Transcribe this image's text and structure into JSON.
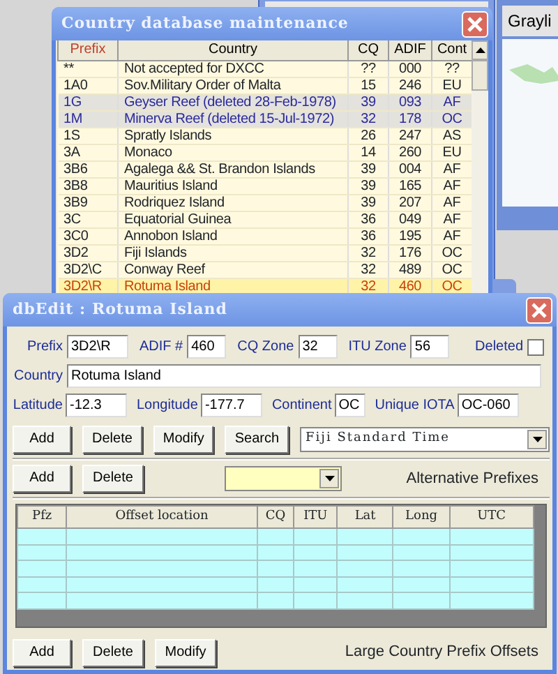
{
  "desktop": {
    "side_tab": "Grayli"
  },
  "country_window": {
    "title": "Country database maintenance",
    "columns": [
      {
        "label": "Prefix",
        "sorted": true
      },
      {
        "label": "Country",
        "sorted": false
      },
      {
        "label": "CQ",
        "sorted": false
      },
      {
        "label": "ADIF",
        "sorted": false
      },
      {
        "label": "Cont",
        "sorted": false
      }
    ],
    "rows": [
      {
        "prefix": "**",
        "country": "Not accepted for DXCC",
        "cq": "??",
        "adif": "000",
        "cont": "??",
        "deleted": false,
        "selected": false
      },
      {
        "prefix": "1A0",
        "country": "Sov.Military Order of Malta",
        "cq": "15",
        "adif": "246",
        "cont": "EU",
        "deleted": false,
        "selected": false
      },
      {
        "prefix": "1G",
        "country": "Geyser Reef  (deleted 28-Feb-1978)",
        "cq": "39",
        "adif": "093",
        "cont": "AF",
        "deleted": true,
        "selected": false
      },
      {
        "prefix": "1M",
        "country": "Minerva Reef  (deleted 15-Jul-1972)",
        "cq": "32",
        "adif": "178",
        "cont": "OC",
        "deleted": true,
        "selected": false
      },
      {
        "prefix": "1S",
        "country": "Spratly Islands",
        "cq": "26",
        "adif": "247",
        "cont": "AS",
        "deleted": false,
        "selected": false
      },
      {
        "prefix": "3A",
        "country": "Monaco",
        "cq": "14",
        "adif": "260",
        "cont": "EU",
        "deleted": false,
        "selected": false
      },
      {
        "prefix": "3B6",
        "country": "Agalega && St. Brandon Islands",
        "cq": "39",
        "adif": "004",
        "cont": "AF",
        "deleted": false,
        "selected": false
      },
      {
        "prefix": "3B8",
        "country": "Mauritius Island",
        "cq": "39",
        "adif": "165",
        "cont": "AF",
        "deleted": false,
        "selected": false
      },
      {
        "prefix": "3B9",
        "country": "Rodriquez Island",
        "cq": "39",
        "adif": "207",
        "cont": "AF",
        "deleted": false,
        "selected": false
      },
      {
        "prefix": "3C",
        "country": "Equatorial Guinea",
        "cq": "36",
        "adif": "049",
        "cont": "AF",
        "deleted": false,
        "selected": false
      },
      {
        "prefix": "3C0",
        "country": "Annobon Island",
        "cq": "36",
        "adif": "195",
        "cont": "AF",
        "deleted": false,
        "selected": false
      },
      {
        "prefix": "3D2",
        "country": "Fiji Islands",
        "cq": "32",
        "adif": "176",
        "cont": "OC",
        "deleted": false,
        "selected": false
      },
      {
        "prefix": "3D2\\C",
        "country": "Conway Reef",
        "cq": "32",
        "adif": "489",
        "cont": "OC",
        "deleted": false,
        "selected": false
      },
      {
        "prefix": "3D2\\R",
        "country": "Rotuma Island",
        "cq": "32",
        "adif": "460",
        "cont": "OC",
        "deleted": false,
        "selected": true
      }
    ]
  },
  "edit_window": {
    "title": "dbEdit : Rotuma Island",
    "fields": [
      {
        "label": "Prefix",
        "value": "3D2\\R",
        "kind": "mid"
      },
      {
        "label": "ADIF #",
        "value": "460",
        "kind": "short"
      },
      {
        "label": "CQ Zone",
        "value": "32",
        "kind": "short"
      },
      {
        "label": "ITU Zone",
        "value": "56",
        "kind": "short"
      },
      {
        "label": "Country",
        "value": "Rotuma Island",
        "kind": "wide"
      },
      {
        "label": "Latitude",
        "value": "-12.3",
        "kind": "mid"
      },
      {
        "label": "Longitude",
        "value": "-177.7",
        "kind": "mid"
      },
      {
        "label": "Continent",
        "value": "OC",
        "kind": "tiny"
      },
      {
        "label": "Unique IOTA",
        "value": "OC-060",
        "kind": "mid"
      }
    ],
    "deleted": {
      "label": "Deleted",
      "checked": false
    },
    "buttons": [
      "Add",
      "Delete",
      "Modify",
      "Search"
    ],
    "timezone": "Fiji Standard Time",
    "alt_buttons": [
      "Add",
      "Delete"
    ],
    "alt_label": "Alternative Prefixes",
    "offset_columns": [
      "Pfz",
      "Offset location",
      "CQ",
      "ITU",
      "Lat",
      "Long",
      "UTC"
    ],
    "offset_buttons": [
      "Add",
      "Delete",
      "Modify"
    ],
    "offset_label": "Large Country Prefix Offsets"
  }
}
